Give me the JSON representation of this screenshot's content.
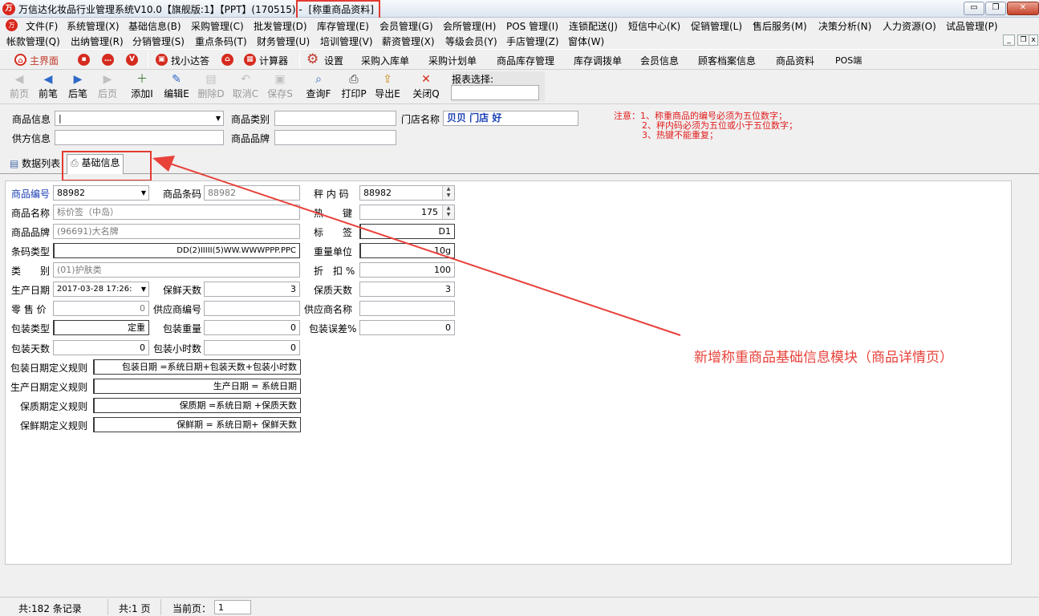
{
  "window": {
    "title_main": "万信达化妆品行业管理系统V10.0【旗舰版:1】【PPT】(170515) - ",
    "title_form": "[称重商品资料]",
    "minimize": "▭",
    "restore": "❐",
    "close": "✕"
  },
  "menu1": [
    "文件(F)",
    "系统管理(X)",
    "基础信息(B)",
    "采购管理(C)",
    "批发管理(D)",
    "库存管理(E)",
    "会员管理(G)",
    "会所管理(H)",
    "POS 管理(I)",
    "连锁配送(J)",
    "短信中心(K)",
    "促销管理(L)",
    "售后服务(M)",
    "决策分析(N)",
    "人力资源(O)",
    "试品管理(P)"
  ],
  "menu2": [
    "帐款管理(Q)",
    "出纳管理(R)",
    "分销管理(S)",
    "重点条码(T)",
    "财务管理(U)",
    "培训管理(V)",
    "薪资管理(X)",
    "等级会员(Y)",
    "手店管理(Z)",
    "窗体(W)"
  ],
  "quickbar": {
    "home": "主界面",
    "xiaoda": "找小达答",
    "calculator": "计算器",
    "settings": "设置",
    "items": [
      "采购入库单",
      "采购计划单",
      "商品库存管理",
      "库存调拨单",
      "会员信息",
      "顾客档案信息",
      "商品资料",
      "POS端"
    ]
  },
  "toolbar": {
    "buttons": [
      {
        "label": "前页",
        "icon": "◀",
        "enabled": false
      },
      {
        "label": "前笔",
        "icon": "◀",
        "enabled": true
      },
      {
        "label": "后笔",
        "icon": "▶",
        "enabled": true
      },
      {
        "label": "后页",
        "icon": "▶",
        "enabled": false
      },
      {
        "label": "添加I",
        "icon": "＋",
        "enabled": true
      },
      {
        "label": "编辑E",
        "icon": "✎",
        "enabled": true
      },
      {
        "label": "删除D",
        "icon": "▤",
        "enabled": false
      },
      {
        "label": "取消C",
        "icon": "↶",
        "enabled": false
      },
      {
        "label": "保存S",
        "icon": "▣",
        "enabled": false
      },
      {
        "label": "查询F",
        "icon": "⌕",
        "enabled": true
      },
      {
        "label": "打印P",
        "icon": "⎙",
        "enabled": true
      },
      {
        "label": "导出E",
        "icon": "⇪",
        "enabled": true
      },
      {
        "label": "关闭Q",
        "icon": "✕",
        "enabled": true
      }
    ],
    "report_label": "报表选择:",
    "report_value": ""
  },
  "filters": {
    "product_info_label": "商品信息",
    "product_info_value": "|",
    "category_label": "商品类别",
    "category_value": "",
    "store_label": "门店名称",
    "store_value": "贝贝 门店 好",
    "supplier_label": "供方信息",
    "supplier_value": "",
    "brand_label": "商品品牌",
    "brand_value": ""
  },
  "notes": [
    "注意：1、称重商品的编号必须为五位数字；",
    "2、秤内码必须为五位或小于五位数字；",
    "3、热键不能重复；"
  ],
  "tabs": [
    "数据列表",
    "基础信息"
  ],
  "form": {
    "code_label": "商品编号",
    "code_value": "88982",
    "barcode_label": "商品条码",
    "barcode_value": "88982",
    "scale_code_label": "秤 内 码",
    "scale_code_value": "88982",
    "name_label": "商品名称",
    "name_value": "标价签（中岛）",
    "hotkey_label": "热　　键",
    "hotkey_value": "175",
    "brand_label": "商品品牌",
    "brand_value": "(96691)大名牌",
    "tag_label": "标　　签",
    "tag_value": "D1",
    "barcode_type_label": "条码类型",
    "barcode_type_value": "DD(2)IIIII(5)WW.WWWPPP.PPC",
    "weight_unit_label": "重量单位",
    "weight_unit_value": "10g",
    "category_label": "类　　别",
    "category_value": "(01)护肤类",
    "discount_label": "折　扣 %",
    "discount_value": "100",
    "prod_date_label": "生产日期",
    "prod_date_value": "2017-03-28 17:26:",
    "fresh_days_label": "保鲜天数",
    "fresh_days_value": "3",
    "shelf_days_label": "保质天数",
    "shelf_days_value": "3",
    "retail_label": "零 售 价",
    "retail_value": "0",
    "supplier_code_label": "供应商编号",
    "supplier_code_value": "",
    "supplier_name_label": "供应商名称",
    "supplier_name_value": "",
    "pack_type_label": "包装类型",
    "pack_type_value": "定重",
    "pack_weight_label": "包装重量",
    "pack_weight_value": "0",
    "pack_error_label": "包装误差%",
    "pack_error_value": "0",
    "pack_days_label": "包装天数",
    "pack_days_value": "0",
    "pack_hours_label": "包装小时数",
    "pack_hours_value": "0",
    "pack_rule_label": "包装日期定义规则",
    "pack_rule_value": "包装日期 =系统日期+包装天数+包装小时数",
    "prod_rule_label": "生产日期定义规则",
    "prod_rule_value": "生产日期 = 系统日期",
    "shelf_rule_label": "保质期定义规则",
    "shelf_rule_value": "保质期 =系统日期 +保质天数",
    "fresh_rule_label": "保鲜期定义规则",
    "fresh_rule_value": "保鲜期 = 系统日期+ 保鲜天数"
  },
  "annotation": "新增称重商品基础信息模块（商品详情页）",
  "status": {
    "records": "共:182 条记录",
    "pages": "共:1 页",
    "current_label": "当前页：",
    "current_value": "1"
  },
  "colors": {
    "highlight_red": "#e23b34",
    "note_red": "#e21b1b",
    "store_blue": "#1a3fb5",
    "label_blue": "#1a3fb5"
  }
}
